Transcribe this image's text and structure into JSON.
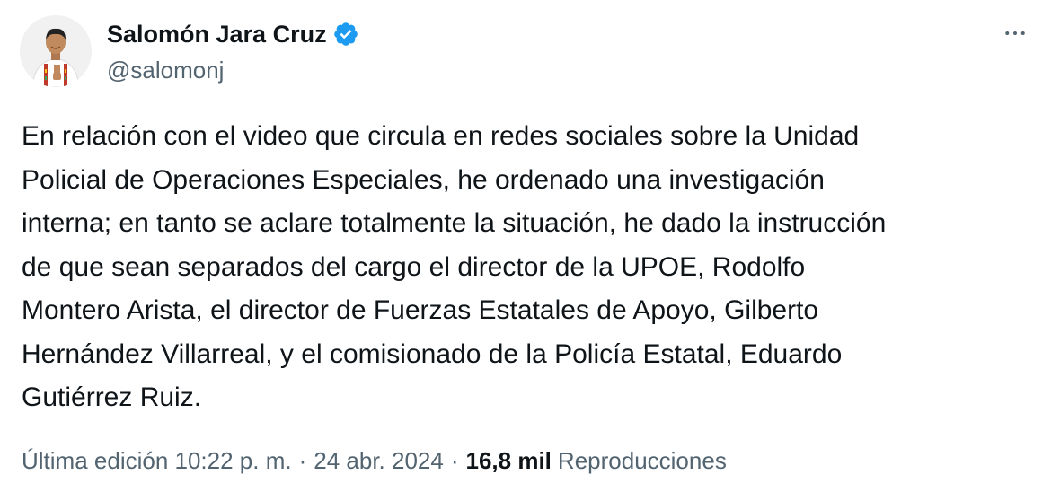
{
  "author": {
    "display_name": "Salomón Jara Cruz",
    "handle": "@salomonj",
    "verified": true,
    "verified_color": "#1d9bf0"
  },
  "tweet": {
    "lines": [
      "En relación con el video que circula en redes sociales sobre la Unidad",
      "Policial de Operaciones Especiales, he ordenado una investigación",
      "interna; en tanto se aclare totalmente la situación, he dado la instrucción",
      "de que sean separados del cargo el director de la UPOE, Rodolfo",
      "Montero Arista, el director de Fuerzas Estatales de Apoyo, Gilberto",
      "Hernández Villarreal, y el comisionado de la Policía Estatal, Eduardo",
      "Gutiérrez Ruiz."
    ]
  },
  "meta": {
    "edited_time": "Última edición 10:22 p. m.",
    "separator": "·",
    "date": "24 abr. 2024",
    "views_count": "16,8 mil",
    "views_label": "Reproducciones"
  },
  "icons": {
    "more": "more-horizontal-icon",
    "verified": "verified-badge-icon"
  },
  "colors": {
    "text_primary": "#0f1419",
    "text_secondary": "#536471",
    "background": "#ffffff"
  }
}
